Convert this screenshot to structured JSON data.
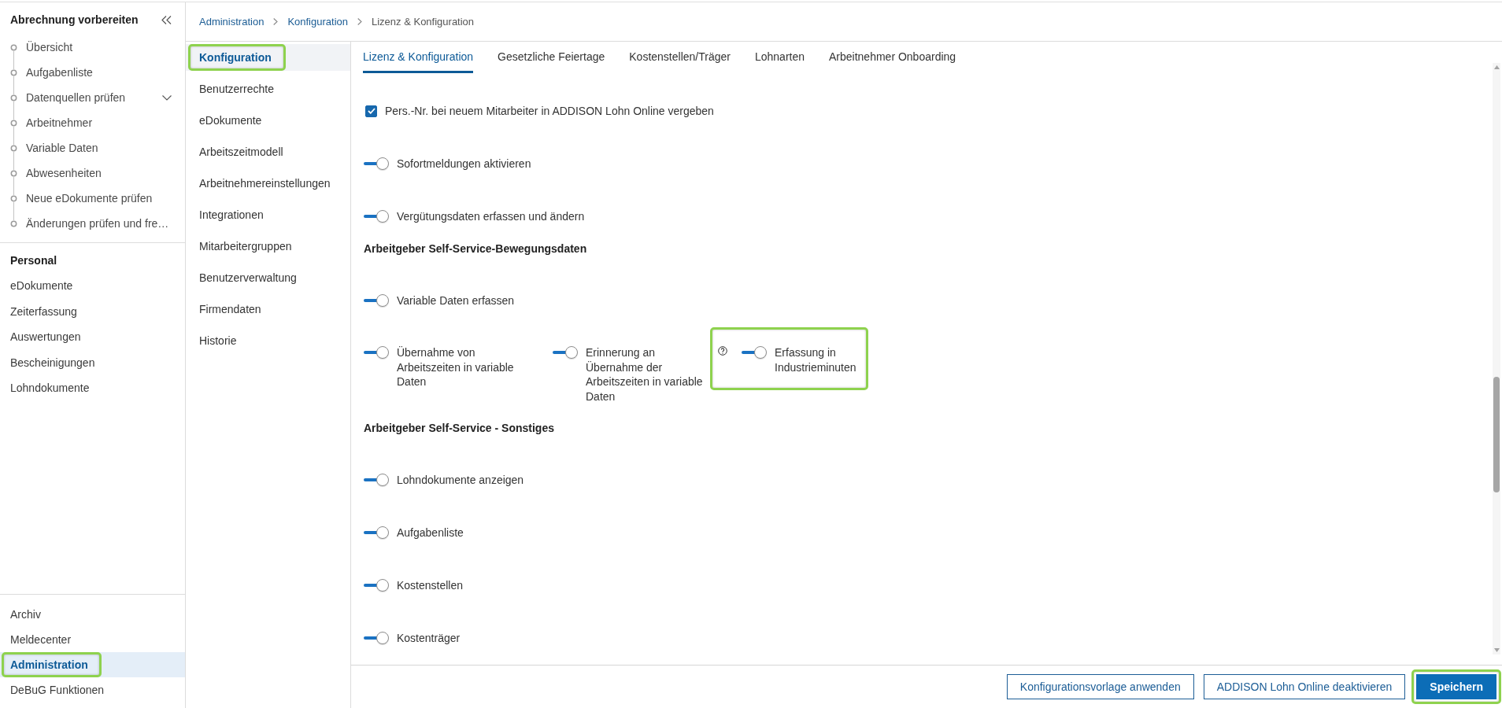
{
  "sidebar": {
    "title": "Abrechnung vorbereiten",
    "steps": [
      {
        "label": "Übersicht",
        "expandable": false,
        "selected": false
      },
      {
        "label": "Aufgabenliste",
        "expandable": false,
        "selected": false
      },
      {
        "label": "Datenquellen prüfen",
        "expandable": true,
        "selected": false
      },
      {
        "label": "Arbeitnehmer",
        "expandable": false,
        "selected": false
      },
      {
        "label": "Variable Daten",
        "expandable": false,
        "selected": false
      },
      {
        "label": "Abwesenheiten",
        "expandable": false,
        "selected": false
      },
      {
        "label": "Neue eDokumente prüfen",
        "expandable": false,
        "selected": false
      },
      {
        "label": "Änderungen prüfen und fre…",
        "expandable": false,
        "selected": false
      }
    ],
    "section": {
      "title": "Personal",
      "items": [
        {
          "label": "eDokumente",
          "selected": false
        },
        {
          "label": "Zeiterfassung",
          "selected": false
        },
        {
          "label": "Auswertungen",
          "selected": false
        },
        {
          "label": "Bescheinigungen",
          "selected": false
        },
        {
          "label": "Lohndokumente",
          "selected": false
        }
      ]
    },
    "bottom_items": [
      {
        "label": "Archiv",
        "selected": false,
        "highlighted": false
      },
      {
        "label": "Meldecenter",
        "selected": false,
        "highlighted": false
      },
      {
        "label": "Administration",
        "selected": true,
        "highlighted": true
      },
      {
        "label": "DeBuG Funktionen",
        "selected": false,
        "highlighted": false
      }
    ]
  },
  "breadcrumb": [
    {
      "label": "Administration",
      "kind": "link"
    },
    {
      "label": "Konfiguration",
      "kind": "link"
    },
    {
      "label": "Lizenz & Konfiguration",
      "kind": "current"
    }
  ],
  "config_nav": [
    {
      "label": "Konfiguration",
      "selected": true,
      "highlighted": true
    },
    {
      "label": "Benutzerrechte",
      "selected": false,
      "highlighted": false
    },
    {
      "label": "eDokumente",
      "selected": false,
      "highlighted": false
    },
    {
      "label": "Arbeitszeitmodell",
      "selected": false,
      "highlighted": false
    },
    {
      "label": "Arbeitnehmereinstellungen",
      "selected": false,
      "highlighted": false
    },
    {
      "label": "Integrationen",
      "selected": false,
      "highlighted": false
    },
    {
      "label": "Mitarbeitergruppen",
      "selected": false,
      "highlighted": false
    },
    {
      "label": "Benutzerverwaltung",
      "selected": false,
      "highlighted": false
    },
    {
      "label": "Firmendaten",
      "selected": false,
      "highlighted": false
    },
    {
      "label": "Historie",
      "selected": false,
      "highlighted": false
    }
  ],
  "tabs": [
    {
      "label": "Lizenz & Konfiguration",
      "selected": true
    },
    {
      "label": "Gesetzliche Feiertage",
      "selected": false
    },
    {
      "label": "Kostenstellen/Träger",
      "selected": false
    },
    {
      "label": "Lohnarten",
      "selected": false
    },
    {
      "label": "Arbeitnehmer Onboarding",
      "selected": false
    }
  ],
  "settings": [
    {
      "kind": "checkbox",
      "label": "Pers.-Nr. bei neuem Mitarbeiter in ADDISON Lohn Online vergeben",
      "checked": true
    },
    {
      "kind": "toggle",
      "label": "Sofortmeldungen aktivieren",
      "on": true
    },
    {
      "kind": "toggle",
      "label": "Vergütungsdaten erfassen und ändern",
      "on": true
    },
    {
      "kind": "heading",
      "text": "Arbeitgeber Self-Service-Bewegungsdaten"
    },
    {
      "kind": "toggle",
      "label": "Variable Daten erfassen",
      "on": true
    },
    {
      "kind": "toggle_row",
      "items": [
        {
          "label": "Übernahme von Arbeitszeiten in variable Daten",
          "on": true,
          "help": false,
          "highlighted": false
        },
        {
          "label": "Erinnerung an Übernahme der Arbeitszeiten in variable Daten",
          "on": true,
          "help": false,
          "highlighted": false
        },
        {
          "label": "Erfassung in Industrieminuten",
          "on": true,
          "help": true,
          "highlighted": true
        }
      ]
    },
    {
      "kind": "heading",
      "text": "Arbeitgeber Self-Service - Sonstiges"
    },
    {
      "kind": "toggle",
      "label": "Lohndokumente anzeigen",
      "on": true
    },
    {
      "kind": "toggle",
      "label": "Aufgabenliste",
      "on": true
    },
    {
      "kind": "toggle",
      "label": "Kostenstellen",
      "on": true
    },
    {
      "kind": "toggle",
      "label": "Kostenträger",
      "on": true
    }
  ],
  "footer": {
    "buttons": [
      {
        "label": "Konfigurationsvorlage anwenden",
        "kind": "secondary",
        "highlighted": false
      },
      {
        "label": "ADDISON Lohn Online deaktivieren",
        "kind": "secondary",
        "highlighted": false
      },
      {
        "label": "Speichern",
        "kind": "primary",
        "highlighted": true
      }
    ]
  }
}
